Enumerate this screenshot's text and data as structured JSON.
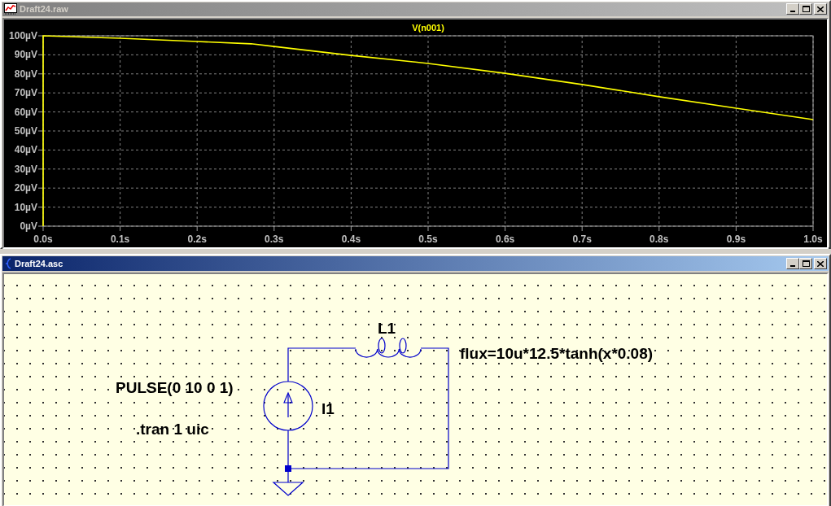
{
  "waveform_window": {
    "title": "Draft24.raw",
    "active": false,
    "chart_data": {
      "type": "line",
      "grid": true,
      "xlim": [
        0,
        1
      ],
      "ylim": [
        0,
        100
      ],
      "xticks": [
        {
          "value": 0,
          "label": "0.0s"
        },
        {
          "value": 0.1,
          "label": "0.1s"
        },
        {
          "value": 0.2,
          "label": "0.2s"
        },
        {
          "value": 0.3,
          "label": "0.3s"
        },
        {
          "value": 0.4,
          "label": "0.4s"
        },
        {
          "value": 0.5,
          "label": "0.5s"
        },
        {
          "value": 0.6,
          "label": "0.6s"
        },
        {
          "value": 0.7,
          "label": "0.7s"
        },
        {
          "value": 0.8,
          "label": "0.8s"
        },
        {
          "value": 0.9,
          "label": "0.9s"
        },
        {
          "value": 1,
          "label": "1.0s"
        }
      ],
      "yticks": [
        {
          "value": 0,
          "label": "0µV"
        },
        {
          "value": 10,
          "label": "10µV"
        },
        {
          "value": 20,
          "label": "20µV"
        },
        {
          "value": 30,
          "label": "30µV"
        },
        {
          "value": 40,
          "label": "40µV"
        },
        {
          "value": 50,
          "label": "50µV"
        },
        {
          "value": 60,
          "label": "60µV"
        },
        {
          "value": 70,
          "label": "70µV"
        },
        {
          "value": 80,
          "label": "80µV"
        },
        {
          "value": 90,
          "label": "90µV"
        },
        {
          "value": 100,
          "label": "100µV"
        }
      ],
      "x": [
        0,
        0,
        0.1,
        0.2,
        0.27,
        0.3,
        0.4,
        0.5,
        0.6,
        0.7,
        0.8,
        0.9,
        1.0
      ],
      "series": [
        {
          "name": "V(n001)",
          "color": "#ffff00",
          "values": [
            0,
            100,
            98.7,
            97,
            95.8,
            94.4,
            89.7,
            85.5,
            80.3,
            74.4,
            68,
            62,
            56
          ]
        }
      ]
    }
  },
  "schematic_window": {
    "title": "Draft24.asc",
    "active": true,
    "components": [
      {
        "kind": "inductor",
        "name": "L1",
        "value": "flux=10u*12.5*tanh(x*0.08)"
      },
      {
        "kind": "current_source",
        "name": "I1",
        "value": "PULSE(0 10 0 1)"
      }
    ],
    "directives": [
      ".tran 1 uic"
    ]
  }
}
